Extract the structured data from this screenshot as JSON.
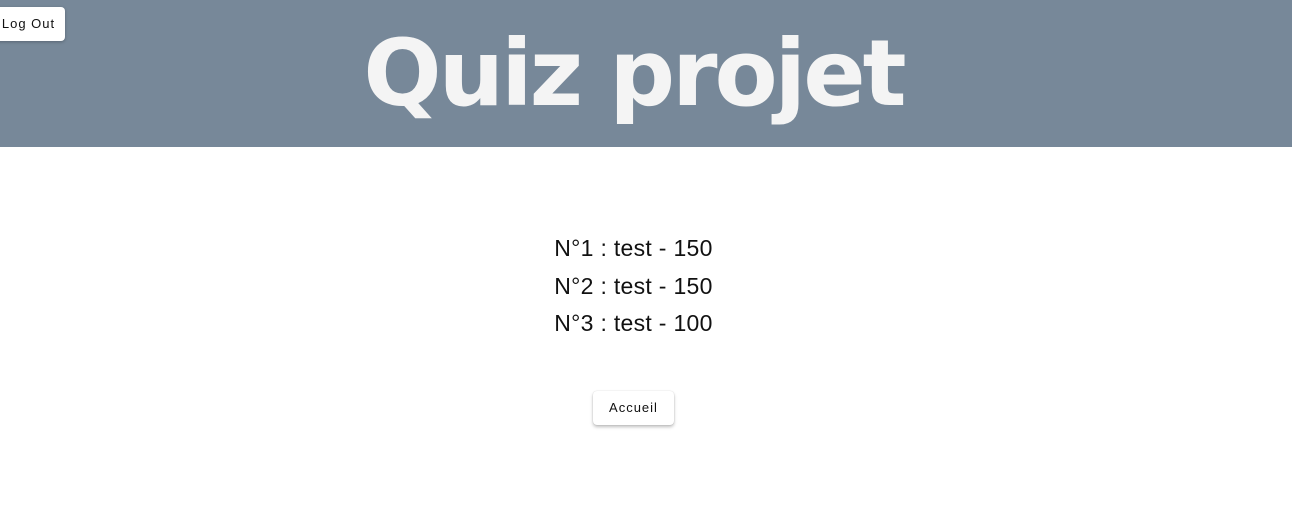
{
  "header": {
    "title": "Quiz projet",
    "logout_label": "Log Out",
    "background_color": "#778899"
  },
  "scores": [
    {
      "text": "N°1 : test - 150"
    },
    {
      "text": "N°2 : test - 150"
    },
    {
      "text": "N°3 : test - 100"
    }
  ],
  "actions": {
    "home_label": "Accueil"
  }
}
